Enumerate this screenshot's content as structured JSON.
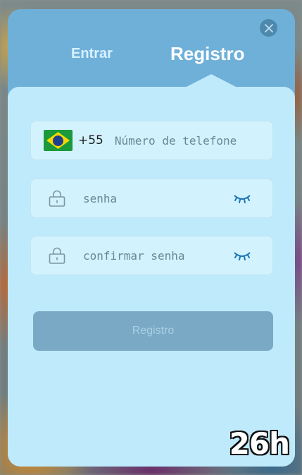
{
  "dialog": {
    "tabs": [
      {
        "label": "Entrar",
        "active": false
      },
      {
        "label": "Registro",
        "active": true
      }
    ],
    "close_icon": "close-icon"
  },
  "form": {
    "phone": {
      "country_code": "+55",
      "placeholder": "Número de telefone",
      "flag_icon": "brazil-flag-icon"
    },
    "password": {
      "placeholder": "senha",
      "icon": "lock-icon",
      "toggle_icon": "eye-closed-icon"
    },
    "confirm_password": {
      "placeholder": "confirmar senha",
      "icon": "lock-icon",
      "toggle_icon": "eye-closed-icon"
    },
    "submit_label": "Registro"
  },
  "watermark": {
    "text": "26h"
  },
  "colors": {
    "header_bg": "#6fb0d9",
    "panel_bg": "#bfeafc",
    "field_bg": "#d2f2fd",
    "button_bg": "#7aa9c5",
    "eye_icon": "#1a74b5"
  }
}
